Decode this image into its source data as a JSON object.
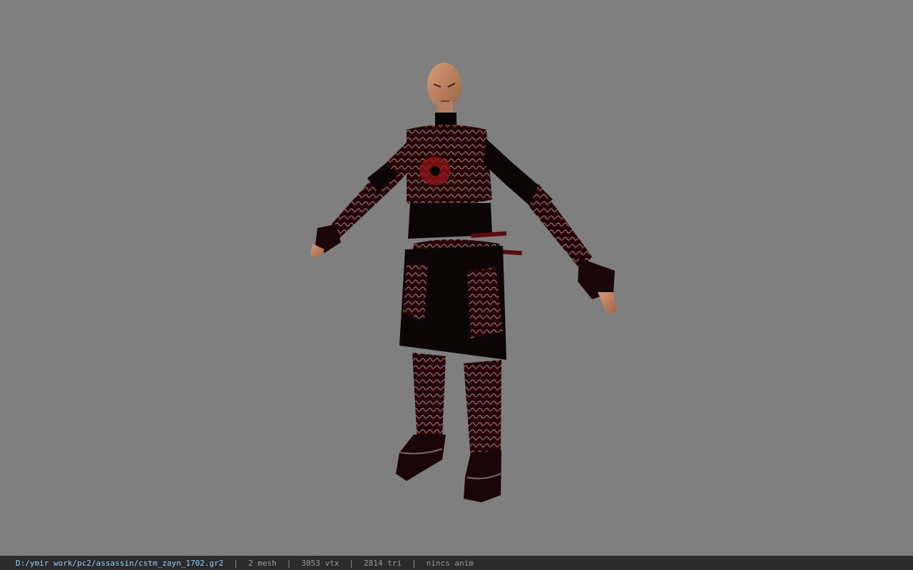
{
  "viewer": {
    "model_name": "cstm_zayn_1702"
  },
  "statusbar": {
    "file_path": "D:/ymir work/pc2/assassin/cstm_zayn_1702.gr2",
    "separator": "|",
    "mesh": "2 mesh",
    "vertices": "3053 vtx",
    "triangles": "2814 tri",
    "animation": "nincs anim"
  },
  "colors": {
    "background": "#7f7f7f",
    "statusbar": "#2b2b2b",
    "path_text": "#8fd0ff",
    "stat_text": "#9a9a9a",
    "armor_dark": "#0b0506",
    "armor_red": "#7a0f14",
    "skin": "#c4896a"
  }
}
